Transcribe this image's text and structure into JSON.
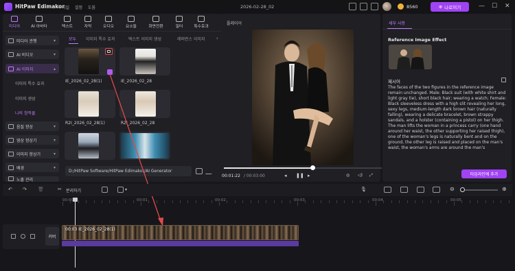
{
  "app": {
    "name": "HitPaw Edimakor",
    "menus": [
      "파일",
      "설정",
      "도움"
    ],
    "doc_title": "2026-02-28_02",
    "credits": "8560",
    "buy_label": "나로이기"
  },
  "toolbar": [
    {
      "label": "미디어",
      "icon": "media-icon"
    },
    {
      "label": "AI 아바타",
      "icon": "avatar-icon"
    },
    {
      "label": "텍스트",
      "icon": "text-icon"
    },
    {
      "label": "자막",
      "icon": "subtitle-icon"
    },
    {
      "label": "오디오",
      "icon": "audio-icon"
    },
    {
      "label": "요소들",
      "icon": "elements-icon"
    },
    {
      "label": "화면전환",
      "icon": "transition-icon"
    },
    {
      "label": "필터",
      "icon": "filter-icon"
    },
    {
      "label": "특수효과",
      "icon": "effects-icon"
    }
  ],
  "sidebar": {
    "items": [
      {
        "label": "미디어 관행"
      },
      {
        "label": "AI 비디오"
      },
      {
        "label": "AI 이미지"
      },
      {
        "label": "음질 향상"
      },
      {
        "label": "영상 향상기"
      },
      {
        "label": "이미지 향상기"
      },
      {
        "label": "배경"
      },
      {
        "label": "노출 관리"
      }
    ],
    "subitems": [
      "이미지 특수 효과",
      "이미지 생성",
      "나의 창작물"
    ]
  },
  "subtabs": [
    "모두",
    "이미지 특수 효과",
    "텍스트 이미지 생성",
    "레퍼런스 이미지"
  ],
  "media": [
    {
      "label": "IE_2026_02_28(1)"
    },
    {
      "label": "IE_2026_02_28"
    },
    {
      "label": "R2I_2026_02_28(1)"
    },
    {
      "label": "R2I_2026_02_28"
    },
    {
      "label": ""
    },
    {
      "label": ""
    }
  ],
  "path": "D:/HitPaw Software/HitPaw Edimakor/AI Generator",
  "player": {
    "title": "플레이어",
    "current": "00:01:22",
    "total": "/ 00:03:00",
    "progress": 0.56
  },
  "details": {
    "tab": "세부 사항",
    "ref_heading": "Reference Image Effect",
    "prompt_heading": "제시어",
    "prompt": "The faces of the two figures in the reference image remain unchanged. Male: Black suit (with white shirt and light gray tie), short black hair; wearing a watch; Female: Black sleeveless dress with a high slit revealing her long, sexy legs, medium-length dark brown hair (naturally falling), wearing a delicate bracelet, brown strappy sandals, and a holster (containing a pistol) on her thigh. The man lifts the woman in a princess carry (one hand around her waist, the other supporting her raised thigh), one of the woman's legs is naturally bent and on the ground, the other leg is raised and placed on the man's waist, the woman's arms are around the man's",
    "add_label": "타임라인에 추가"
  },
  "timeline": {
    "split_label": "분리하기",
    "ruler": [
      "00:00",
      "00:01",
      "00:02",
      "00:03",
      "00:04",
      "00:05"
    ],
    "track_label": "커버",
    "clip_label": "00:03 IE_2026_02_28(1)"
  },
  "colors": {
    "accent": "#a142f4",
    "bg": "#17171b",
    "panel": "#1f1f24"
  }
}
